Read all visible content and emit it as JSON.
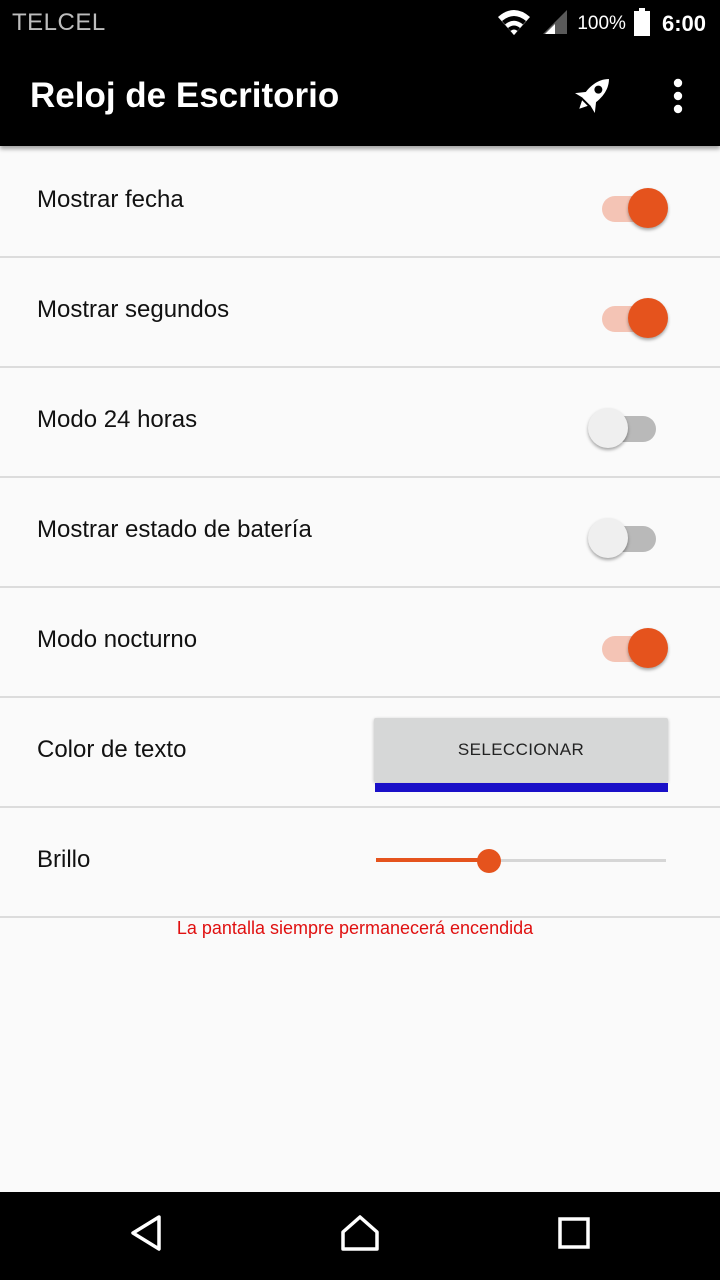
{
  "status_bar": {
    "carrier": "TELCEL",
    "battery": "100%",
    "time": "6:00",
    "icons": [
      "wifi-icon",
      "signal-icon",
      "battery-icon"
    ]
  },
  "app_bar": {
    "title": "Reloj de Escritorio",
    "actions": [
      "rocket-icon",
      "more-vert-icon"
    ]
  },
  "settings": {
    "show_date": {
      "label": "Mostrar fecha",
      "enabled": true
    },
    "show_seconds": {
      "label": "Mostrar segundos",
      "enabled": true
    },
    "mode_24h": {
      "label": "Modo 24 horas",
      "enabled": false
    },
    "show_battery": {
      "label": "Mostrar estado de batería",
      "enabled": false
    },
    "night_mode": {
      "label": "Modo nocturno",
      "enabled": true
    },
    "text_color": {
      "label": "Color de texto",
      "button_label": "SELECCIONAR",
      "selected_color": "#1a10c8"
    },
    "brightness": {
      "label": "Brillo",
      "value": 0.39
    }
  },
  "note": {
    "text": "La pantalla siempre permanecerá encendida",
    "color": "#e01010"
  },
  "colors": {
    "accent": "#e5531d"
  },
  "nav_bar": {
    "buttons": [
      "back-icon",
      "home-icon",
      "recents-icon"
    ]
  }
}
